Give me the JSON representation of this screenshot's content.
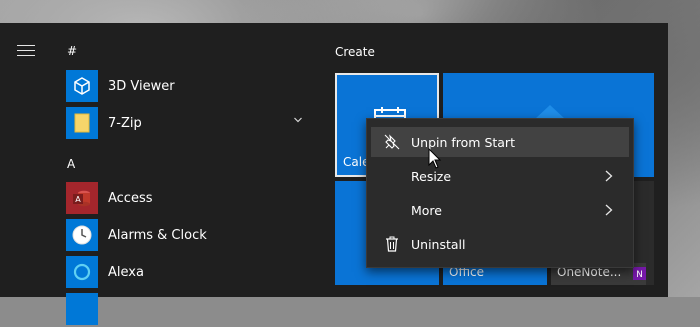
{
  "start_menu": {
    "app_list": {
      "sections": [
        {
          "letter": "#"
        },
        {
          "letter": "A"
        }
      ],
      "apps": [
        {
          "label": "3D Viewer",
          "icon": "3d-viewer-icon"
        },
        {
          "label": "7-Zip",
          "icon": "folder-icon"
        },
        {
          "label": "Access",
          "icon": "access-icon"
        },
        {
          "label": "Alarms & Clock",
          "icon": "clock-icon"
        },
        {
          "label": "Alexa",
          "icon": "alexa-icon"
        }
      ]
    },
    "tiles": {
      "group_title": "Create",
      "items": [
        {
          "label": "Cale",
          "icon": "calendar-icon"
        },
        {
          "label": ""
        },
        {
          "label": ""
        },
        {
          "label": "Office"
        },
        {
          "label": "OneNote..."
        }
      ]
    },
    "context_menu": {
      "items": [
        {
          "label": "Unpin from Start",
          "icon": "unpin-icon"
        },
        {
          "label": "Resize",
          "has_submenu": true
        },
        {
          "label": "More",
          "has_submenu": true
        },
        {
          "label": "Uninstall",
          "icon": "trash-icon"
        }
      ]
    }
  },
  "colors": {
    "menu_bg": "#1f1f1f",
    "tile_blue": "#0a74d6",
    "context_bg": "#2b2b2b",
    "context_hover": "#424242"
  }
}
